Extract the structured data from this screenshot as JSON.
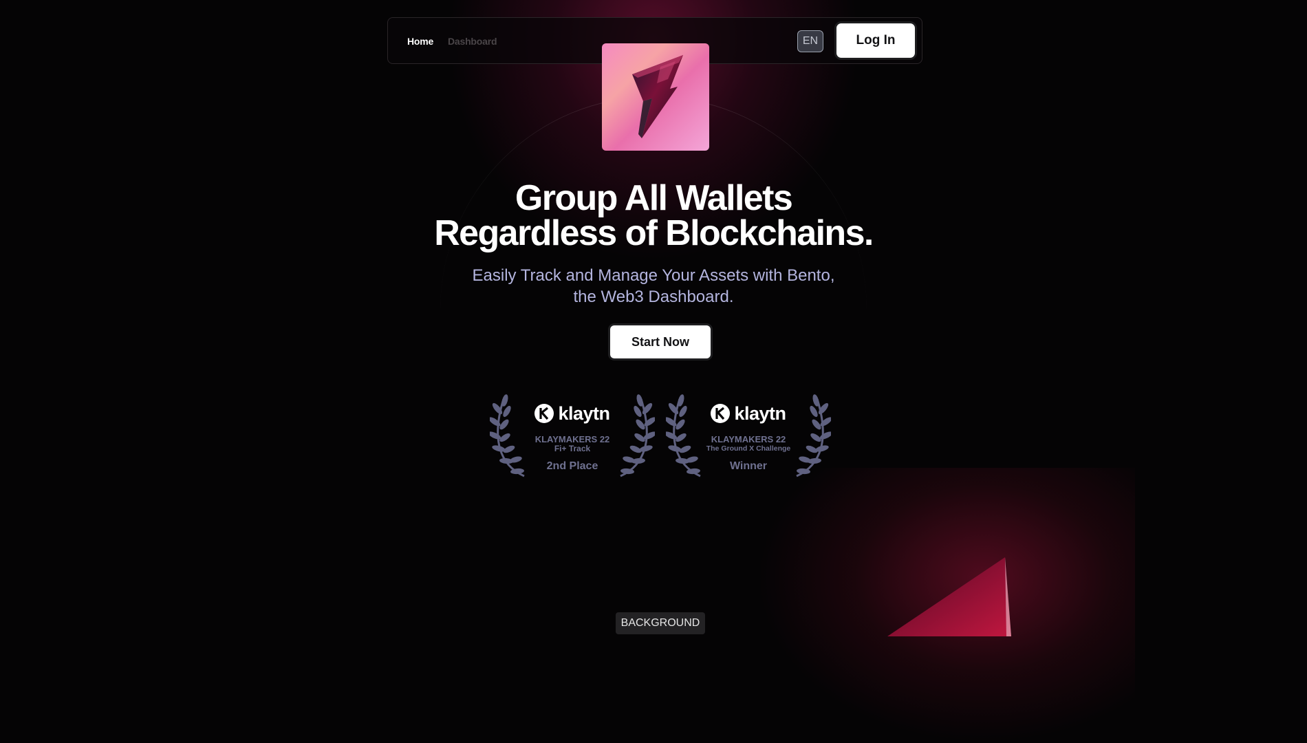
{
  "nav": {
    "home_label": "Home",
    "dashboard_label": "Dashboard",
    "language": "EN",
    "login_label": "Log In"
  },
  "hero": {
    "headline_line1": "Group All Wallets",
    "headline_line2": "Regardless of Blockchains.",
    "subline_line1": "Easily Track and Manage Your Assets with Bento,",
    "subline_line2": "the Web3 Dashboard.",
    "cta_label": "Start Now"
  },
  "awards": [
    {
      "brand": "klaytn",
      "title": "KLAYMAKERS 22",
      "subtitle": "Fi+ Track",
      "rank": "2nd Place"
    },
    {
      "brand": "klaytn",
      "title": "KLAYMAKERS 22",
      "subtitle": "The Ground X Challenge",
      "rank": "Winner"
    }
  ],
  "section_tag": "BACKGROUND",
  "colors": {
    "background": "#050405",
    "accent_pink": "#f58ac0",
    "subtext": "#b4b5df",
    "award_text": "#6f7190"
  },
  "icons": {
    "logo": "bento-logo-icon",
    "brand": "klaytn-logo-icon",
    "laurel": "laurel-wreath-icon"
  }
}
